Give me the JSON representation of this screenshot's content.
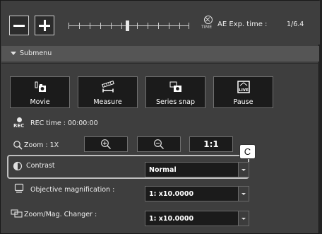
{
  "toolbar": {
    "minus_icon": "minus-icon",
    "plus_icon": "plus-icon",
    "time_icon_text": "TIME",
    "ae_label": "AE Exp. time :",
    "ae_value": "1/6.4"
  },
  "submenu": {
    "label": "Submenu"
  },
  "buttons": [
    {
      "label": "Movie",
      "icon": "camera-icon"
    },
    {
      "label": "Measure",
      "icon": "ruler-icon"
    },
    {
      "label": "Series snap",
      "icon": "series-camera-icon"
    },
    {
      "label": "Pause",
      "icon": "live-icon"
    }
  ],
  "rec": {
    "icon_text": "REC",
    "label": "REC time : 00:00:00"
  },
  "zoom": {
    "label": "Zoom : 1X",
    "one_to_one": "1:1"
  },
  "contrast": {
    "label": "Contrast",
    "value": "Normal"
  },
  "objective": {
    "label": "Objective magnification :",
    "value": "1: x10.0000"
  },
  "changer": {
    "label": "Zoom/Mag. Changer :",
    "value": "1: x10.0000"
  },
  "callout": "C",
  "colors": {
    "panel_bg": "#3e3e3e",
    "button_bg": "#1b1b1b",
    "text": "#eeeeee"
  }
}
